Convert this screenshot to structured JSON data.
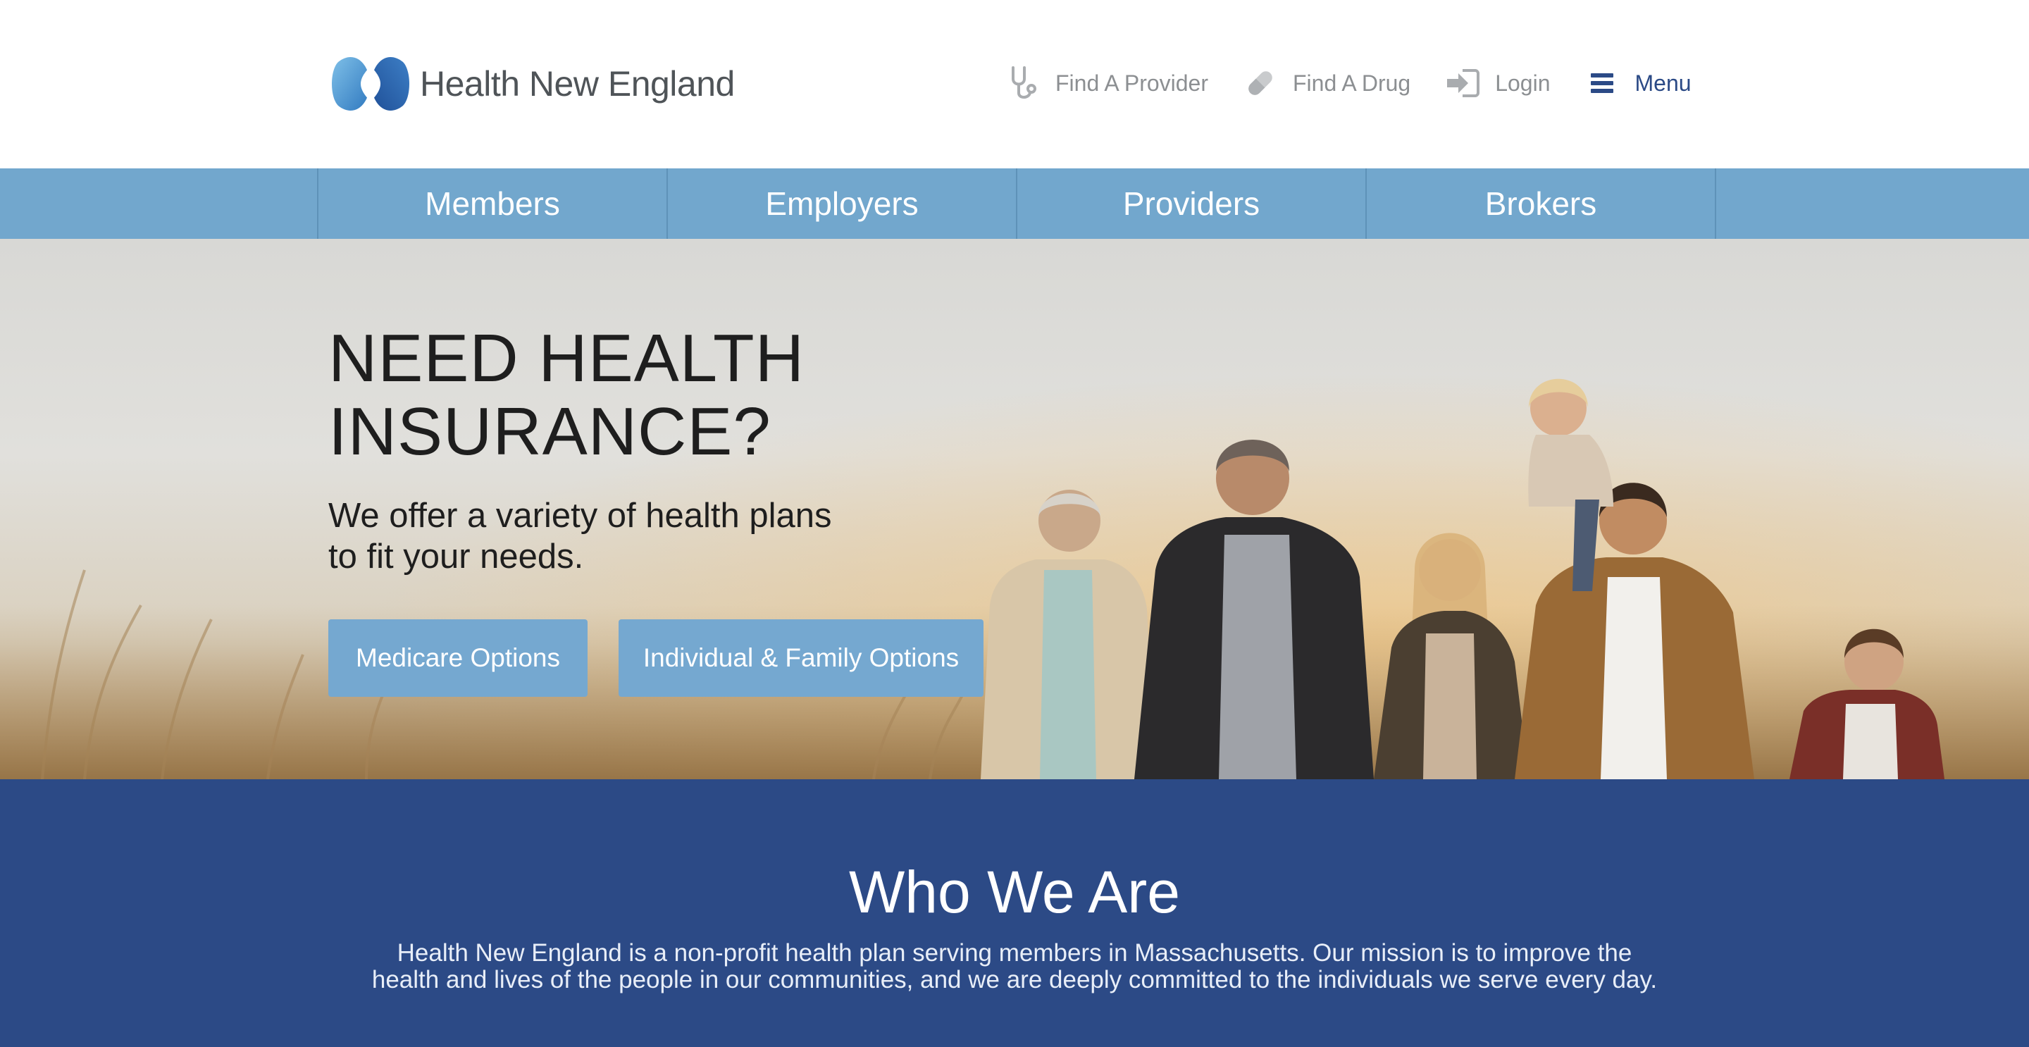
{
  "header": {
    "brand": "Health New England",
    "utility": [
      {
        "label": "Find A Provider",
        "icon": "stethoscope-icon"
      },
      {
        "label": "Find A Drug",
        "icon": "pill-icon"
      },
      {
        "label": "Login",
        "icon": "login-icon"
      },
      {
        "label": "Menu",
        "icon": "hamburger-menu-icon"
      }
    ]
  },
  "nav": {
    "tabs": [
      "Members",
      "Employers",
      "Providers",
      "Brokers"
    ]
  },
  "hero": {
    "title_line1": "NEED HEALTH",
    "title_line2": "INSURANCE?",
    "subtitle_line1": "We offer a variety of health plans",
    "subtitle_line2": "to fit your needs.",
    "buttons": [
      "Medicare Options",
      "Individual & Family Options"
    ]
  },
  "who": {
    "title": "Who We Are",
    "body_line1": "Health New England is a non-profit health plan serving members in Massachusetts. Our mission is to improve the",
    "body_line2": "health and lives of the people in our communities, and we are deeply committed to the individuals we serve every day."
  },
  "colors": {
    "nav_blue": "#72a7cd",
    "button_blue": "#75a8d0",
    "navy": "#2c4a86",
    "menu_text": "#2b4a86",
    "utility_text": "#8c8f92",
    "logo_text": "#4f5458"
  }
}
